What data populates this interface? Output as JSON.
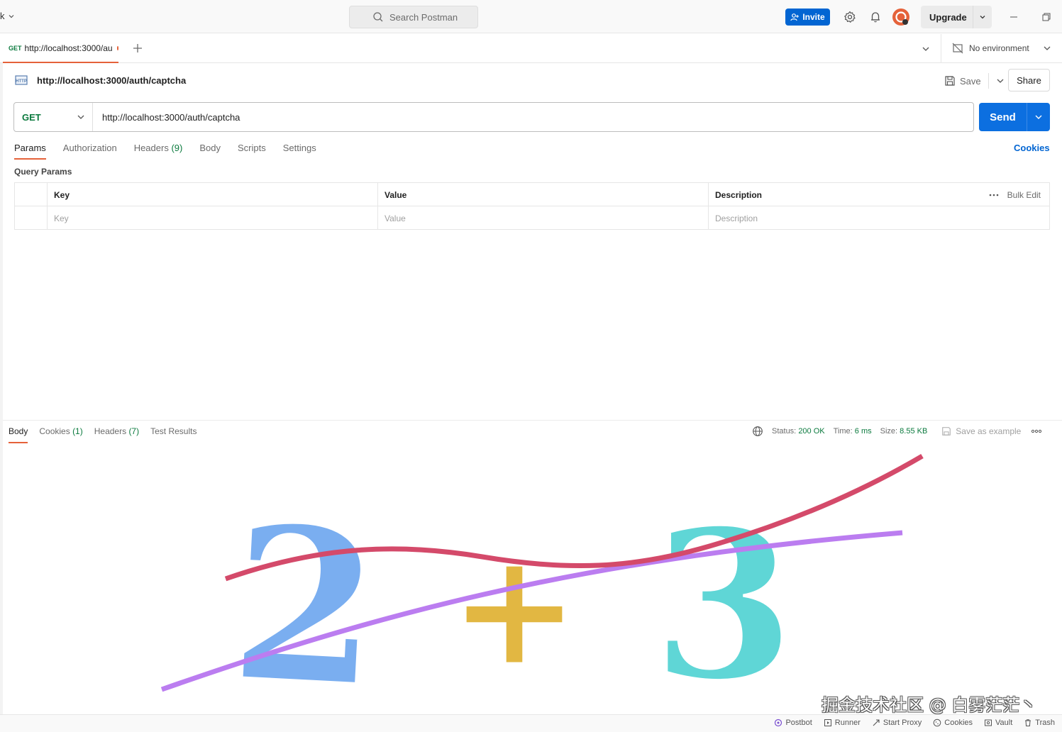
{
  "titlebar": {
    "workspace": "k",
    "search_placeholder": "Search Postman",
    "invite_label": "Invite",
    "upgrade_label": "Upgrade"
  },
  "tabbar": {
    "tab_method": "GET",
    "tab_title": "http://localhost:3000/au",
    "environment": "No environment"
  },
  "request": {
    "title": "http://localhost:3000/auth/captcha",
    "save_label": "Save",
    "share_label": "Share",
    "method": "GET",
    "url": "http://localhost:3000/auth/captcha",
    "send_label": "Send",
    "tabs": [
      {
        "label": "Params",
        "count": ""
      },
      {
        "label": "Authorization",
        "count": ""
      },
      {
        "label": "Headers",
        "count": "(9)"
      },
      {
        "label": "Body",
        "count": ""
      },
      {
        "label": "Scripts",
        "count": ""
      },
      {
        "label": "Settings",
        "count": ""
      }
    ],
    "cookies_label": "Cookies",
    "query_params_title": "Query Params",
    "params_table": {
      "headers": [
        "Key",
        "Value",
        "Description"
      ],
      "placeholders": [
        "Key",
        "Value",
        "Description"
      ],
      "bulk_edit_label": "Bulk Edit"
    }
  },
  "response": {
    "tabs": [
      {
        "label": "Body",
        "count": ""
      },
      {
        "label": "Cookies",
        "count": "(1)"
      },
      {
        "label": "Headers",
        "count": "(7)"
      },
      {
        "label": "Test Results",
        "count": ""
      }
    ],
    "status_label": "Status:",
    "status_value": "200 OK",
    "time_label": "Time:",
    "time_value": "6 ms",
    "size_label": "Size:",
    "size_value": "8.55 KB",
    "save_example_label": "Save as example",
    "captcha_text": [
      "2",
      "+",
      "3"
    ],
    "colors": {
      "digit1": "#7aaef0",
      "plus": "#e2b742",
      "digit2": "#5fd6d6",
      "line_red": "#d44a6a",
      "line_purple": "#bb7df0"
    }
  },
  "watermark": "掘金技术社区 @ 白雾茫茫丶",
  "statusbar": {
    "items": [
      "Postbot",
      "Runner",
      "Start Proxy",
      "Cookies",
      "Vault",
      "Trash"
    ]
  },
  "colors": {
    "accent": "#e5623a",
    "primary": "#0c6fe0",
    "get_green": "#0b7a3e"
  }
}
